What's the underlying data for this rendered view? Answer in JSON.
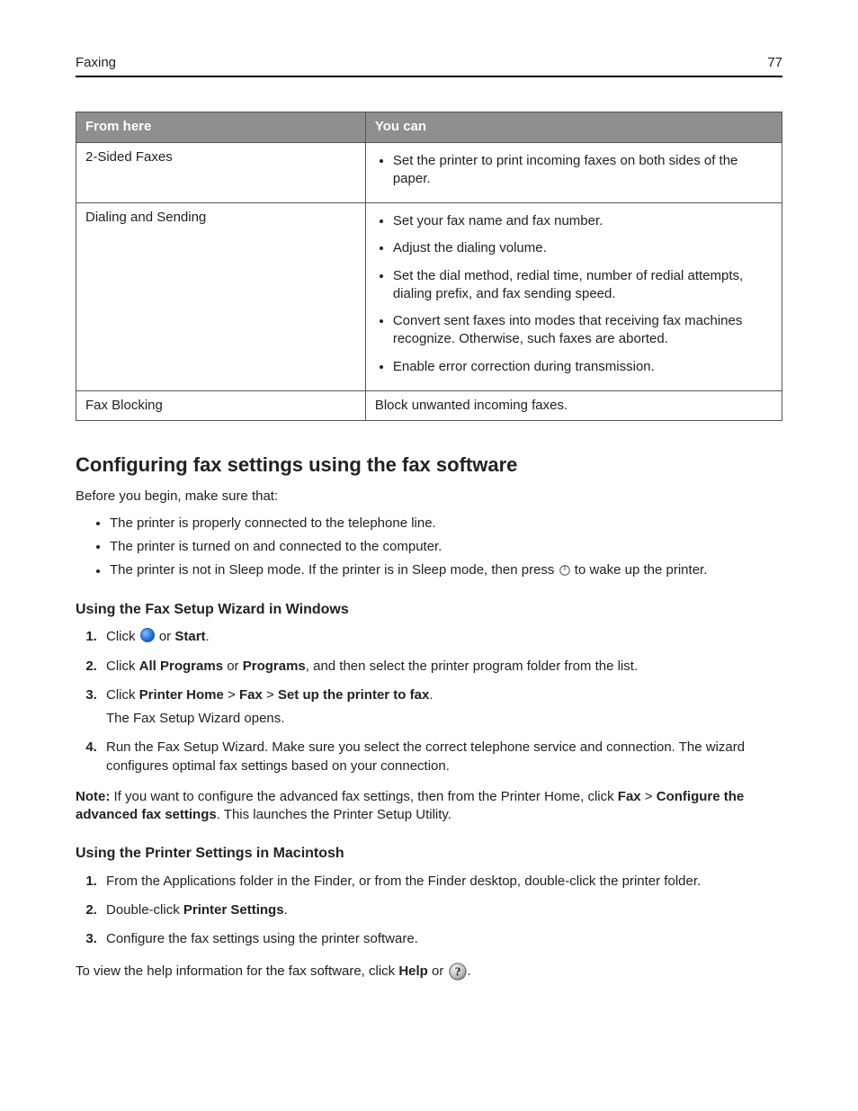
{
  "header": {
    "section": "Faxing",
    "page_number": "77"
  },
  "table": {
    "head": {
      "col1": "From here",
      "col2": "You can"
    },
    "rows": [
      {
        "from": "2-Sided Faxes",
        "items": [
          "Set the printer to print incoming faxes on both sides of the paper."
        ]
      },
      {
        "from": "Dialing and Sending",
        "items": [
          "Set your fax name and fax number.",
          "Adjust the dialing volume.",
          "Set the dial method, redial time, number of redial attempts, dialing prefix, and fax sending speed.",
          "Convert sent faxes into modes that receiving fax machines recognize. Otherwise, such faxes are aborted.",
          "Enable error correction during transmission."
        ]
      },
      {
        "from": "Fax Blocking",
        "plain": "Block unwanted incoming faxes."
      }
    ]
  },
  "section_title": "Configuring fax settings using the fax software",
  "intro_line": "Before you begin, make sure that:",
  "intro_bullets": [
    "The printer is properly connected to the telephone line.",
    "The printer is turned on and connected to the computer."
  ],
  "intro_bullet3": {
    "pre": "The printer is not in Sleep mode. If the printer is in Sleep mode, then press ",
    "post": " to wake up the printer."
  },
  "windows": {
    "heading": "Using the Fax Setup Wizard in Windows",
    "step1": {
      "pre": "Click ",
      "mid": " or ",
      "bold": "Start",
      "post": "."
    },
    "step2": {
      "t1": "Click ",
      "b1": "All Programs",
      "t2": " or ",
      "b2": "Programs",
      "t3": ", and then select the printer program folder from the list."
    },
    "step3": {
      "t1": "Click ",
      "b1": "Printer Home",
      "sep": " > ",
      "b2": "Fax",
      "b3": "Set up the printer to fax",
      "t2": ".",
      "sub": "The Fax Setup Wizard opens."
    },
    "step4": "Run the Fax Setup Wizard. Make sure you select the correct telephone service and connection. The wizard configures optimal fax settings based on your connection."
  },
  "note": {
    "label": "Note:",
    "t1": " If you want to configure the advanced fax settings, then from the Printer Home, click ",
    "b1": "Fax",
    "sep": " > ",
    "b2": "Configure the advanced fax settings",
    "t2": ". This launches the Printer Setup Utility."
  },
  "mac": {
    "heading": "Using the Printer Settings in Macintosh",
    "step1": "From the Applications folder in the Finder, or from the Finder desktop, double-click the printer folder.",
    "step2": {
      "t1": "Double-click ",
      "b1": "Printer Settings",
      "t2": "."
    },
    "step3": "Configure the fax settings using the printer software."
  },
  "help_line": {
    "t1": "To view the help information for the fax software, click ",
    "b1": "Help",
    "t2": " or ",
    "t3": "."
  }
}
